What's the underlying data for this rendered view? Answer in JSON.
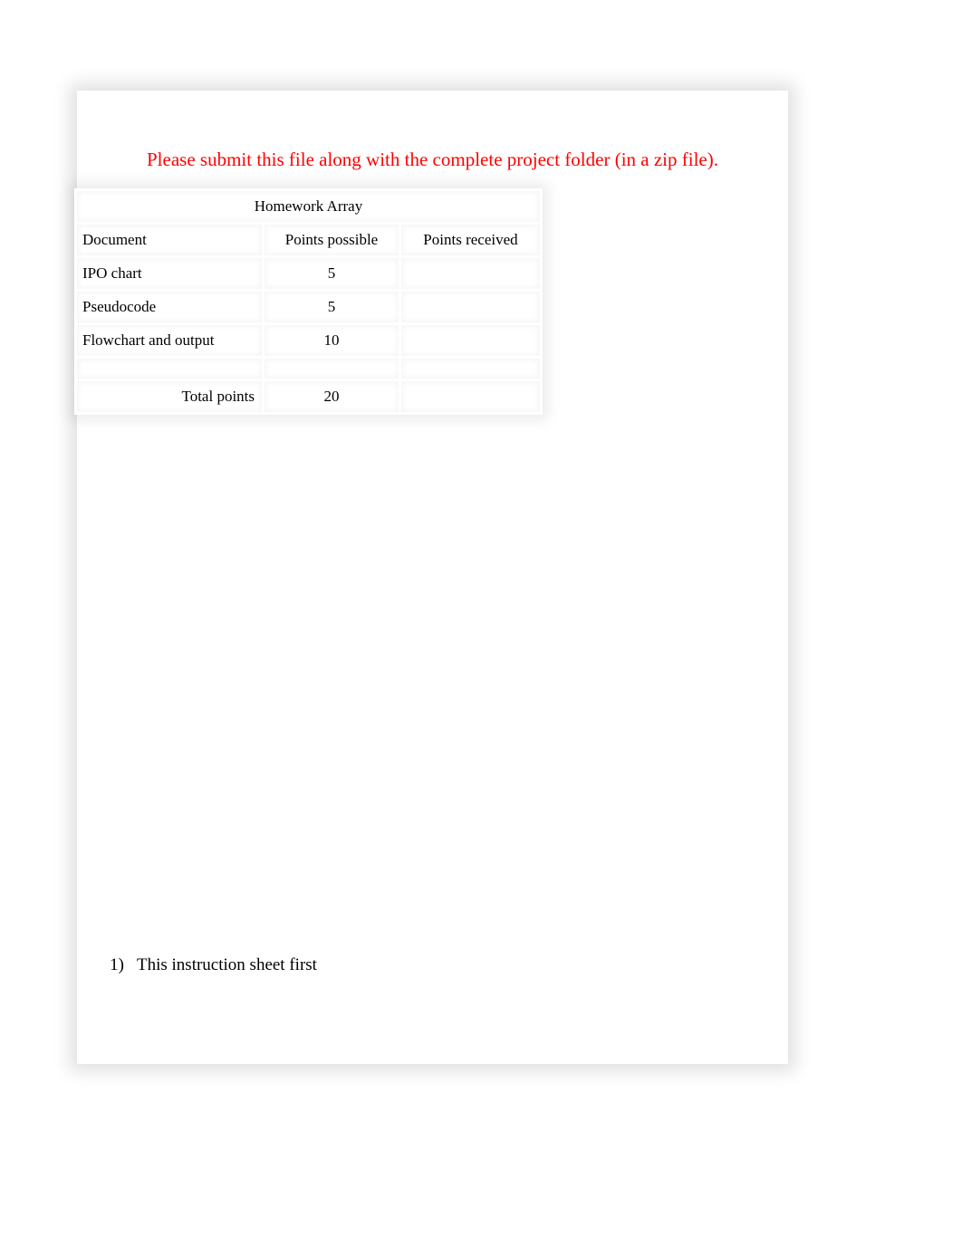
{
  "notice": "Please submit this file along with the complete project folder (in a zip file).",
  "table": {
    "title": "Homework Array",
    "headers": [
      "Document",
      "Points possible",
      "Points received"
    ],
    "rows": [
      {
        "doc": "IPO chart",
        "possible": "5",
        "received": ""
      },
      {
        "doc": "Pseudocode",
        "possible": "5",
        "received": ""
      },
      {
        "doc": "Flowchart and output",
        "possible": "10",
        "received": ""
      }
    ],
    "total": {
      "label": "Total points",
      "possible": "20",
      "received": ""
    }
  },
  "list": {
    "items": [
      {
        "num": "1)",
        "text": "This instruction sheet first"
      }
    ]
  }
}
